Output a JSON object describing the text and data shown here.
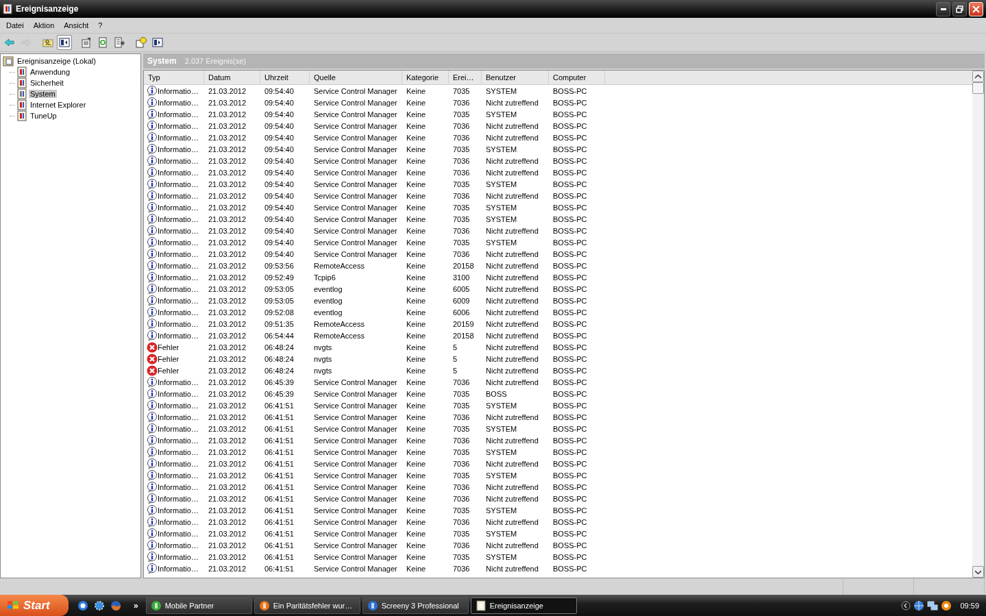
{
  "window": {
    "title": "Ereignisanzeige"
  },
  "menu": [
    "Datei",
    "Aktion",
    "Ansicht",
    "?"
  ],
  "toolbar": [
    {
      "kind": "back",
      "disabled": false,
      "pressed": false
    },
    {
      "kind": "forward",
      "disabled": true,
      "pressed": false
    },
    {
      "kind": "up",
      "disabled": false,
      "pressed": false
    },
    {
      "kind": "tree",
      "disabled": false,
      "pressed": true
    },
    {
      "kind": "properties",
      "disabled": false,
      "pressed": false
    },
    {
      "kind": "refresh",
      "disabled": false,
      "pressed": false
    },
    {
      "kind": "export",
      "disabled": false,
      "pressed": false
    },
    {
      "kind": "help",
      "disabled": false,
      "pressed": false
    },
    {
      "kind": "panel",
      "disabled": false,
      "pressed": false
    }
  ],
  "tree": {
    "label": "Ereignisanzeige (Lokal)",
    "selected": false,
    "children": [
      {
        "label": "Anwendung",
        "selected": false
      },
      {
        "label": "Sicherheit",
        "selected": false
      },
      {
        "label": "System",
        "selected": true
      },
      {
        "label": "Internet Explorer",
        "selected": false
      },
      {
        "label": "TuneUp",
        "selected": false
      }
    ]
  },
  "pane": {
    "title": "System",
    "count": "2.037 Ereignis(se)"
  },
  "table": {
    "columns": [
      "Typ",
      "Datum",
      "Uhrzeit",
      "Quelle",
      "Kategorie",
      "Erei…",
      "Benutzer",
      "Computer"
    ],
    "rows": [
      {
        "kind": "info",
        "cells": [
          "Informatio…",
          "21.03.2012",
          "09:54:40",
          "Service Control Manager",
          "Keine",
          "7035",
          "SYSTEM",
          "BOSS-PC"
        ]
      },
      {
        "kind": "info",
        "cells": [
          "Informatio…",
          "21.03.2012",
          "09:54:40",
          "Service Control Manager",
          "Keine",
          "7036",
          "Nicht zutreffend",
          "BOSS-PC"
        ]
      },
      {
        "kind": "info",
        "cells": [
          "Informatio…",
          "21.03.2012",
          "09:54:40",
          "Service Control Manager",
          "Keine",
          "7035",
          "SYSTEM",
          "BOSS-PC"
        ]
      },
      {
        "kind": "info",
        "cells": [
          "Informatio…",
          "21.03.2012",
          "09:54:40",
          "Service Control Manager",
          "Keine",
          "7036",
          "Nicht zutreffend",
          "BOSS-PC"
        ]
      },
      {
        "kind": "info",
        "cells": [
          "Informatio…",
          "21.03.2012",
          "09:54:40",
          "Service Control Manager",
          "Keine",
          "7036",
          "Nicht zutreffend",
          "BOSS-PC"
        ]
      },
      {
        "kind": "info",
        "cells": [
          "Informatio…",
          "21.03.2012",
          "09:54:40",
          "Service Control Manager",
          "Keine",
          "7035",
          "SYSTEM",
          "BOSS-PC"
        ]
      },
      {
        "kind": "info",
        "cells": [
          "Informatio…",
          "21.03.2012",
          "09:54:40",
          "Service Control Manager",
          "Keine",
          "7036",
          "Nicht zutreffend",
          "BOSS-PC"
        ]
      },
      {
        "kind": "info",
        "cells": [
          "Informatio…",
          "21.03.2012",
          "09:54:40",
          "Service Control Manager",
          "Keine",
          "7036",
          "Nicht zutreffend",
          "BOSS-PC"
        ]
      },
      {
        "kind": "info",
        "cells": [
          "Informatio…",
          "21.03.2012",
          "09:54:40",
          "Service Control Manager",
          "Keine",
          "7035",
          "SYSTEM",
          "BOSS-PC"
        ]
      },
      {
        "kind": "info",
        "cells": [
          "Informatio…",
          "21.03.2012",
          "09:54:40",
          "Service Control Manager",
          "Keine",
          "7036",
          "Nicht zutreffend",
          "BOSS-PC"
        ]
      },
      {
        "kind": "info",
        "cells": [
          "Informatio…",
          "21.03.2012",
          "09:54:40",
          "Service Control Manager",
          "Keine",
          "7035",
          "SYSTEM",
          "BOSS-PC"
        ]
      },
      {
        "kind": "info",
        "cells": [
          "Informatio…",
          "21.03.2012",
          "09:54:40",
          "Service Control Manager",
          "Keine",
          "7035",
          "SYSTEM",
          "BOSS-PC"
        ]
      },
      {
        "kind": "info",
        "cells": [
          "Informatio…",
          "21.03.2012",
          "09:54:40",
          "Service Control Manager",
          "Keine",
          "7036",
          "Nicht zutreffend",
          "BOSS-PC"
        ]
      },
      {
        "kind": "info",
        "cells": [
          "Informatio…",
          "21.03.2012",
          "09:54:40",
          "Service Control Manager",
          "Keine",
          "7035",
          "SYSTEM",
          "BOSS-PC"
        ]
      },
      {
        "kind": "info",
        "cells": [
          "Informatio…",
          "21.03.2012",
          "09:54:40",
          "Service Control Manager",
          "Keine",
          "7036",
          "Nicht zutreffend",
          "BOSS-PC"
        ]
      },
      {
        "kind": "info",
        "cells": [
          "Informatio…",
          "21.03.2012",
          "09:53:56",
          "RemoteAccess",
          "Keine",
          "20158",
          "Nicht zutreffend",
          "BOSS-PC"
        ]
      },
      {
        "kind": "info",
        "cells": [
          "Informatio…",
          "21.03.2012",
          "09:52:49",
          "Tcpip6",
          "Keine",
          "3100",
          "Nicht zutreffend",
          "BOSS-PC"
        ]
      },
      {
        "kind": "info",
        "cells": [
          "Informatio…",
          "21.03.2012",
          "09:53:05",
          "eventlog",
          "Keine",
          "6005",
          "Nicht zutreffend",
          "BOSS-PC"
        ]
      },
      {
        "kind": "info",
        "cells": [
          "Informatio…",
          "21.03.2012",
          "09:53:05",
          "eventlog",
          "Keine",
          "6009",
          "Nicht zutreffend",
          "BOSS-PC"
        ]
      },
      {
        "kind": "info",
        "cells": [
          "Informatio…",
          "21.03.2012",
          "09:52:08",
          "eventlog",
          "Keine",
          "6006",
          "Nicht zutreffend",
          "BOSS-PC"
        ]
      },
      {
        "kind": "info",
        "cells": [
          "Informatio…",
          "21.03.2012",
          "09:51:35",
          "RemoteAccess",
          "Keine",
          "20159",
          "Nicht zutreffend",
          "BOSS-PC"
        ]
      },
      {
        "kind": "info",
        "cells": [
          "Informatio…",
          "21.03.2012",
          "06:54:44",
          "RemoteAccess",
          "Keine",
          "20158",
          "Nicht zutreffend",
          "BOSS-PC"
        ]
      },
      {
        "kind": "error",
        "cells": [
          "Fehler",
          "21.03.2012",
          "06:48:24",
          "nvgts",
          "Keine",
          "5",
          "Nicht zutreffend",
          "BOSS-PC"
        ]
      },
      {
        "kind": "error",
        "cells": [
          "Fehler",
          "21.03.2012",
          "06:48:24",
          "nvgts",
          "Keine",
          "5",
          "Nicht zutreffend",
          "BOSS-PC"
        ]
      },
      {
        "kind": "error",
        "cells": [
          "Fehler",
          "21.03.2012",
          "06:48:24",
          "nvgts",
          "Keine",
          "5",
          "Nicht zutreffend",
          "BOSS-PC"
        ]
      },
      {
        "kind": "info",
        "cells": [
          "Informatio…",
          "21.03.2012",
          "06:45:39",
          "Service Control Manager",
          "Keine",
          "7036",
          "Nicht zutreffend",
          "BOSS-PC"
        ]
      },
      {
        "kind": "info",
        "cells": [
          "Informatio…",
          "21.03.2012",
          "06:45:39",
          "Service Control Manager",
          "Keine",
          "7035",
          "BOSS",
          "BOSS-PC"
        ]
      },
      {
        "kind": "info",
        "cells": [
          "Informatio…",
          "21.03.2012",
          "06:41:51",
          "Service Control Manager",
          "Keine",
          "7035",
          "SYSTEM",
          "BOSS-PC"
        ]
      },
      {
        "kind": "info",
        "cells": [
          "Informatio…",
          "21.03.2012",
          "06:41:51",
          "Service Control Manager",
          "Keine",
          "7036",
          "Nicht zutreffend",
          "BOSS-PC"
        ]
      },
      {
        "kind": "info",
        "cells": [
          "Informatio…",
          "21.03.2012",
          "06:41:51",
          "Service Control Manager",
          "Keine",
          "7035",
          "SYSTEM",
          "BOSS-PC"
        ]
      },
      {
        "kind": "info",
        "cells": [
          "Informatio…",
          "21.03.2012",
          "06:41:51",
          "Service Control Manager",
          "Keine",
          "7036",
          "Nicht zutreffend",
          "BOSS-PC"
        ]
      },
      {
        "kind": "info",
        "cells": [
          "Informatio…",
          "21.03.2012",
          "06:41:51",
          "Service Control Manager",
          "Keine",
          "7035",
          "SYSTEM",
          "BOSS-PC"
        ]
      },
      {
        "kind": "info",
        "cells": [
          "Informatio…",
          "21.03.2012",
          "06:41:51",
          "Service Control Manager",
          "Keine",
          "7036",
          "Nicht zutreffend",
          "BOSS-PC"
        ]
      },
      {
        "kind": "info",
        "cells": [
          "Informatio…",
          "21.03.2012",
          "06:41:51",
          "Service Control Manager",
          "Keine",
          "7035",
          "SYSTEM",
          "BOSS-PC"
        ]
      },
      {
        "kind": "info",
        "cells": [
          "Informatio…",
          "21.03.2012",
          "06:41:51",
          "Service Control Manager",
          "Keine",
          "7036",
          "Nicht zutreffend",
          "BOSS-PC"
        ]
      },
      {
        "kind": "info",
        "cells": [
          "Informatio…",
          "21.03.2012",
          "06:41:51",
          "Service Control Manager",
          "Keine",
          "7036",
          "Nicht zutreffend",
          "BOSS-PC"
        ]
      },
      {
        "kind": "info",
        "cells": [
          "Informatio…",
          "21.03.2012",
          "06:41:51",
          "Service Control Manager",
          "Keine",
          "7035",
          "SYSTEM",
          "BOSS-PC"
        ]
      },
      {
        "kind": "info",
        "cells": [
          "Informatio…",
          "21.03.2012",
          "06:41:51",
          "Service Control Manager",
          "Keine",
          "7036",
          "Nicht zutreffend",
          "BOSS-PC"
        ]
      },
      {
        "kind": "info",
        "cells": [
          "Informatio…",
          "21.03.2012",
          "06:41:51",
          "Service Control Manager",
          "Keine",
          "7035",
          "SYSTEM",
          "BOSS-PC"
        ]
      },
      {
        "kind": "info",
        "cells": [
          "Informatio…",
          "21.03.2012",
          "06:41:51",
          "Service Control Manager",
          "Keine",
          "7036",
          "Nicht zutreffend",
          "BOSS-PC"
        ]
      },
      {
        "kind": "info",
        "cells": [
          "Informatio…",
          "21.03.2012",
          "06:41:51",
          "Service Control Manager",
          "Keine",
          "7035",
          "SYSTEM",
          "BOSS-PC"
        ]
      },
      {
        "kind": "info",
        "cells": [
          "Informatio…",
          "21.03.2012",
          "06:41:51",
          "Service Control Manager",
          "Keine",
          "7036",
          "Nicht zutreffend",
          "BOSS-PC"
        ]
      }
    ]
  },
  "taskbar": {
    "start": "Start",
    "more": "»",
    "tasks": [
      {
        "label": "Mobile Partner",
        "kind": "green",
        "selected": false
      },
      {
        "label": "Ein Paritätsfehler wur…",
        "kind": "firefox",
        "selected": false
      },
      {
        "label": "Screeny 3 Professional",
        "kind": "screeny",
        "selected": false
      },
      {
        "label": "Ereignisanzeige",
        "kind": "viewer",
        "selected": true
      }
    ],
    "clock": "09:59"
  }
}
